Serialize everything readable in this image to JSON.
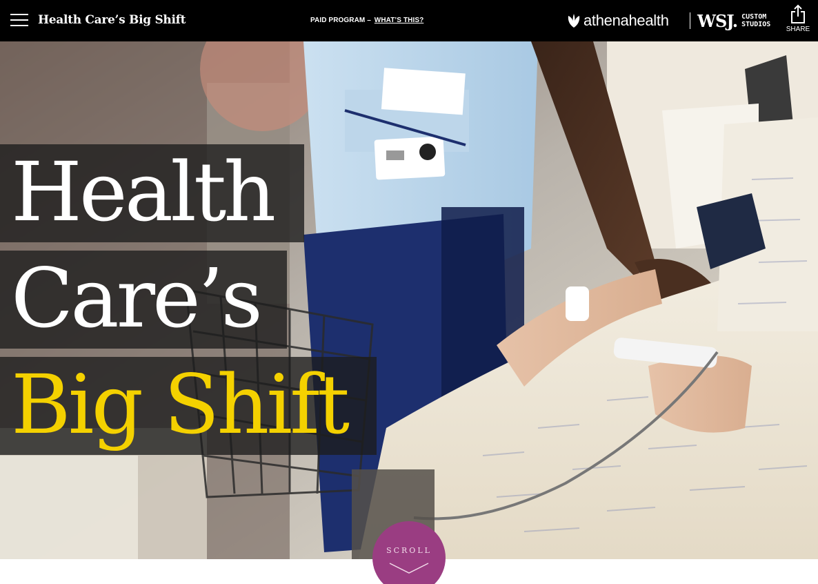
{
  "header": {
    "site_title": "Health Care’s Big Shift",
    "paid_program": "PAID PROGRAM –",
    "whats_this": "WHAT’S THIS?",
    "sponsor_logo": "athenahealth",
    "publisher_logo_mark": "WSJ.",
    "publisher_logo_sub_1": "CUSTOM",
    "publisher_logo_sub_2": "STUDIOS",
    "share_label": "SHARE",
    "menu_icon": "hamburger-menu-icon",
    "share_icon": "share-upload-icon"
  },
  "hero": {
    "headline_line_1": "Health",
    "headline_line_2": "Care’s",
    "headline_line_3": "Big Shift",
    "accent_color": "#f4d100"
  },
  "scroll": {
    "label": "SCROLL",
    "icon": "chevron-down-icon",
    "color": "#9a3d82"
  }
}
